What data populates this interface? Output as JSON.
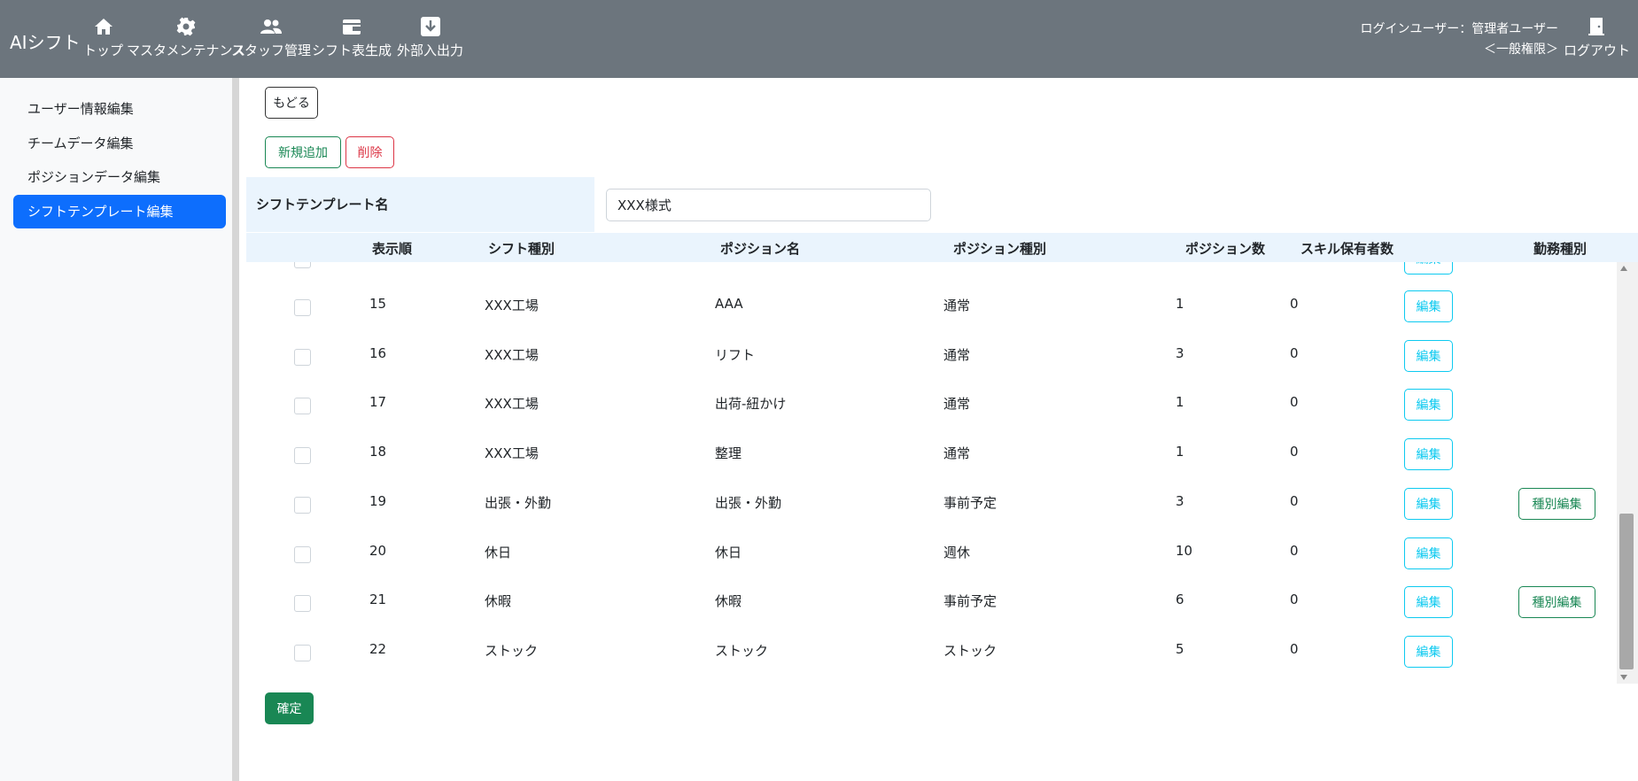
{
  "header": {
    "brand": "AIシフト",
    "nav": [
      {
        "label": "トップ",
        "icon": "home-icon"
      },
      {
        "label": "マスタメンテナンス",
        "icon": "gear-icon"
      },
      {
        "label": "スタッフ管理",
        "icon": "users-icon"
      },
      {
        "label": "シフト表生成",
        "icon": "wallet-icon"
      },
      {
        "label": "外部入出力",
        "icon": "download-icon"
      }
    ],
    "user_line1": "ログインユーザー：管理者ユーザー",
    "user_line2": "＜一般権限＞",
    "logout_label": "ログアウト"
  },
  "sidebar": {
    "items": [
      {
        "label": "ユーザー情報編集",
        "active": false
      },
      {
        "label": "チームデータ編集",
        "active": false
      },
      {
        "label": "ポジションデータ編集",
        "active": false
      },
      {
        "label": "シフトテンプレート編集",
        "active": true
      }
    ]
  },
  "main": {
    "back_label": "もどる",
    "add_label": "新規追加",
    "delete_label": "削除",
    "template_name_label": "シフトテンプレート名",
    "template_name_value": "XXX様式",
    "confirm_label": "確定",
    "columns": [
      "表示順",
      "シフト種別",
      "ポジション名",
      "ポジション種別",
      "ポジション数",
      "スキル保有者数",
      "勤務種別"
    ],
    "edit_label": "編集",
    "kind_edit_label": "種別編集",
    "rows": [
      {
        "order": "15",
        "shift": "XXX工場",
        "position": "AAA",
        "ptype": "通常",
        "count": "1",
        "skill": "0",
        "kind_edit": false
      },
      {
        "order": "16",
        "shift": "XXX工場",
        "position": "リフト",
        "ptype": "通常",
        "count": "3",
        "skill": "0",
        "kind_edit": false
      },
      {
        "order": "17",
        "shift": "XXX工場",
        "position": "出荷-紐かけ",
        "ptype": "通常",
        "count": "1",
        "skill": "0",
        "kind_edit": false
      },
      {
        "order": "18",
        "shift": "XXX工場",
        "position": "整理",
        "ptype": "通常",
        "count": "1",
        "skill": "0",
        "kind_edit": false
      },
      {
        "order": "19",
        "shift": "出張・外勤",
        "position": "出張・外勤",
        "ptype": "事前予定",
        "count": "3",
        "skill": "0",
        "kind_edit": true
      },
      {
        "order": "20",
        "shift": "休日",
        "position": "休日",
        "ptype": "週休",
        "count": "10",
        "skill": "0",
        "kind_edit": false
      },
      {
        "order": "21",
        "shift": "休暇",
        "position": "休暇",
        "ptype": "事前予定",
        "count": "6",
        "skill": "0",
        "kind_edit": true
      },
      {
        "order": "22",
        "shift": "ストック",
        "position": "ストック",
        "ptype": "ストック",
        "count": "5",
        "skill": "0",
        "kind_edit": false
      }
    ]
  },
  "colors": {
    "header_bg": "#6c757d",
    "active_bg": "#0d6efd",
    "success": "#198754",
    "danger": "#dc3545",
    "info": "#0dcaf0",
    "table_head_bg": "#eaf4fd"
  }
}
